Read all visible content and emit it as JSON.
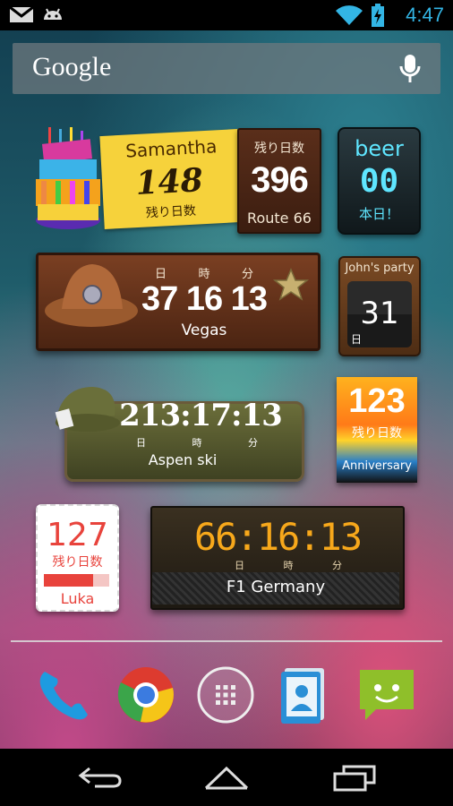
{
  "status_bar": {
    "time": "4:47",
    "icons": [
      "gmail-icon",
      "android-icon",
      "wifi-icon",
      "battery-charging-icon"
    ]
  },
  "search": {
    "label": "Google",
    "icon": "mic-icon"
  },
  "widgets": {
    "samantha": {
      "name": "Samantha",
      "count": "148",
      "unit": "残り日数"
    },
    "route66": {
      "unit": "残り日数",
      "count": "396",
      "name": "Route 66"
    },
    "beer": {
      "name": "beer",
      "count": "00",
      "note": "本日！"
    },
    "vegas": {
      "labels": [
        "日",
        "時",
        "分"
      ],
      "count": "37 16 13",
      "name": "Vegas"
    },
    "johns_party": {
      "name": "John's party",
      "count": "31",
      "unit": "日"
    },
    "aspen": {
      "count": "213:17:13",
      "labels": [
        "日",
        "時",
        "分"
      ],
      "name": "Aspen ski"
    },
    "anniversary": {
      "count": "123",
      "unit": "残り日数",
      "name": "Anniversary"
    },
    "luka": {
      "count": "127",
      "unit": "残り日数",
      "name": "Luka",
      "progress_fraction": 0.75
    },
    "f1": {
      "count": "66:16:13",
      "labels": [
        "日",
        "時",
        "分"
      ],
      "name": "F1 Germany"
    }
  },
  "dock": [
    "phone-icon",
    "chrome-icon",
    "app-drawer-icon",
    "contacts-icon",
    "messaging-icon"
  ],
  "navbar": [
    "back-icon",
    "home-icon",
    "recents-icon"
  ],
  "colors": {
    "holo_blue": "#33b5e5",
    "beer_cyan": "#5fe6ff",
    "f1_orange": "#f7a81b",
    "luka_red": "#e8433c"
  }
}
